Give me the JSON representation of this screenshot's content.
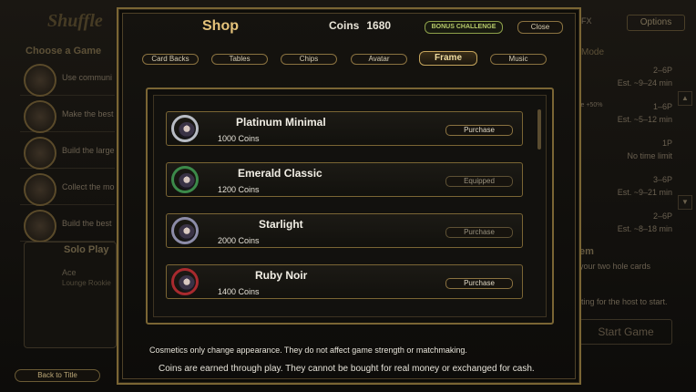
{
  "background": {
    "logo": "Shuffle",
    "choose_title": "Choose a Game",
    "games": [
      {
        "text": "Use communi"
      },
      {
        "text": "Make the best"
      },
      {
        "text": "Build the large"
      },
      {
        "text": "Collect the mo"
      },
      {
        "text": "Build the best"
      }
    ],
    "solo_title": "Solo Play",
    "ace_name": "Ace",
    "ace_sub": "Lounge Rookie",
    "back_label": "Back to Title",
    "sfx_label": "FX",
    "options_label": "Options",
    "mode_label": "Mode",
    "rows": [
      {
        "a": "2–6P",
        "b": "Est. ~9–24 min"
      },
      {
        "a": "1–6P",
        "b": "Est. ~5–12 min"
      },
      {
        "a": "1P",
        "b": "No time limit"
      },
      {
        "a": "3–6P",
        "b": "Est. ~9–21 min"
      },
      {
        "a": "2–6P",
        "b": "Est. ~8–18 min"
      }
    ],
    "rate_tag": "ce +50%",
    "item_title": "em",
    "hole_text": "your two hole cards",
    "wait_text": "iting for the host to start.",
    "start_label": "Start Game"
  },
  "shop": {
    "title": "Shop",
    "coins_label": "Coins",
    "coins_value": "1680",
    "bonus_label": "BONUS CHALLENGE",
    "close_label": "Close",
    "tabs": [
      {
        "label": "Card Backs"
      },
      {
        "label": "Tables"
      },
      {
        "label": "Chips"
      },
      {
        "label": "Avatar"
      },
      {
        "label": "Frame"
      },
      {
        "label": "Music"
      }
    ],
    "items": [
      {
        "name": "Platinum Minimal",
        "price": "1000 Coins",
        "action": "Purchase"
      },
      {
        "name": "Emerald Classic",
        "price": "1200 Coins",
        "action": "Equipped"
      },
      {
        "name": "Starlight",
        "price": "2000 Coins",
        "action": "Purchase"
      },
      {
        "name": "Ruby Noir",
        "price": "1400 Coins",
        "action": "Purchase"
      }
    ],
    "note1": "Cosmetics only change appearance. They do not affect game strength or matchmaking.",
    "note2": "Coins are earned through play. They cannot be bought for real money or exchanged for cash.",
    "colors": {
      "gold": "#e4c27a",
      "border": "#7a6534",
      "bonus": "#b8cc6a"
    }
  }
}
